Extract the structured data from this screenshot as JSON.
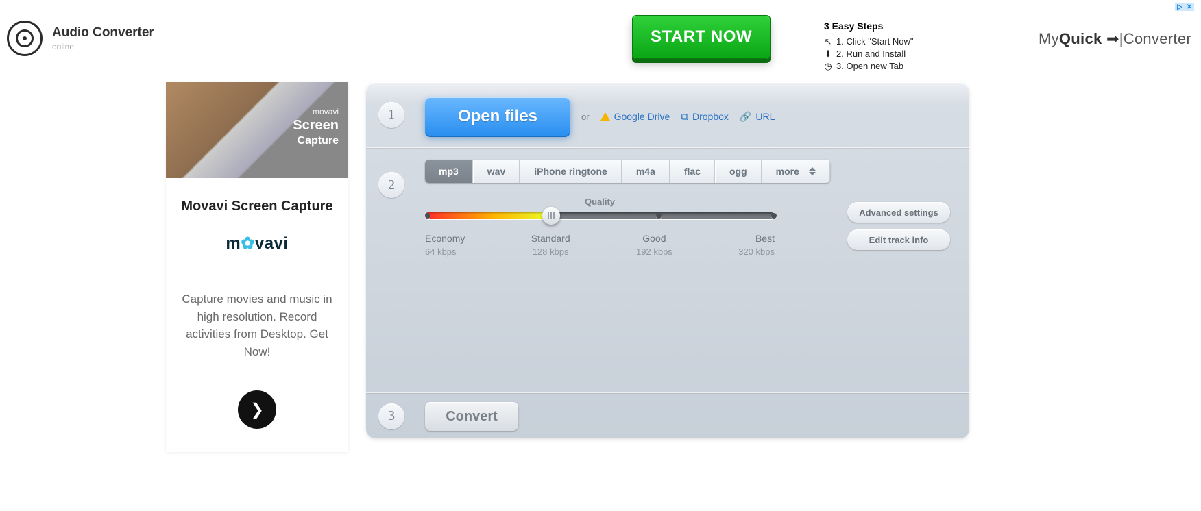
{
  "logo": {
    "title": "Audio Converter",
    "subtitle": "online"
  },
  "topBanner": {
    "startNow": "START NOW",
    "stepsHead": "3 Easy Steps",
    "step1": "1. Click \"Start Now\"",
    "step2": "2. Run and Install",
    "step3": "3. Open new Tab",
    "brandLight1": "My",
    "brandBold": "Quick",
    "brandLight2": "Converter"
  },
  "sideAd": {
    "imgBrand1": "movavi",
    "imgBrand2": "Screen",
    "imgBrand3": "Capture",
    "heading": "Movavi Screen Capture",
    "brandPart1": "m",
    "brandAccent": "✿",
    "brandPart2": "vavi",
    "paragraph": "Capture movies and music in high resolution. Record activities from Desktop. Get Now!"
  },
  "panel": {
    "step1No": "1",
    "step2No": "2",
    "step3No": "3",
    "openFiles": "Open files",
    "or": "or",
    "gdrive": "Google Drive",
    "dropbox": "Dropbox",
    "url": "URL",
    "tabs": {
      "mp3": "mp3",
      "wav": "wav",
      "iphone": "iPhone ringtone",
      "m4a": "m4a",
      "flac": "flac",
      "ogg": "ogg",
      "more": "more"
    },
    "qualityTitle": "Quality",
    "ticks": {
      "economy": {
        "label": "Economy",
        "sub": "64 kbps"
      },
      "standard": {
        "label": "Standard",
        "sub": "128 kbps"
      },
      "good": {
        "label": "Good",
        "sub": "192 kbps"
      },
      "best": {
        "label": "Best",
        "sub": "320 kbps"
      }
    },
    "advanced": "Advanced settings",
    "editTrack": "Edit track info",
    "convert": "Convert"
  }
}
